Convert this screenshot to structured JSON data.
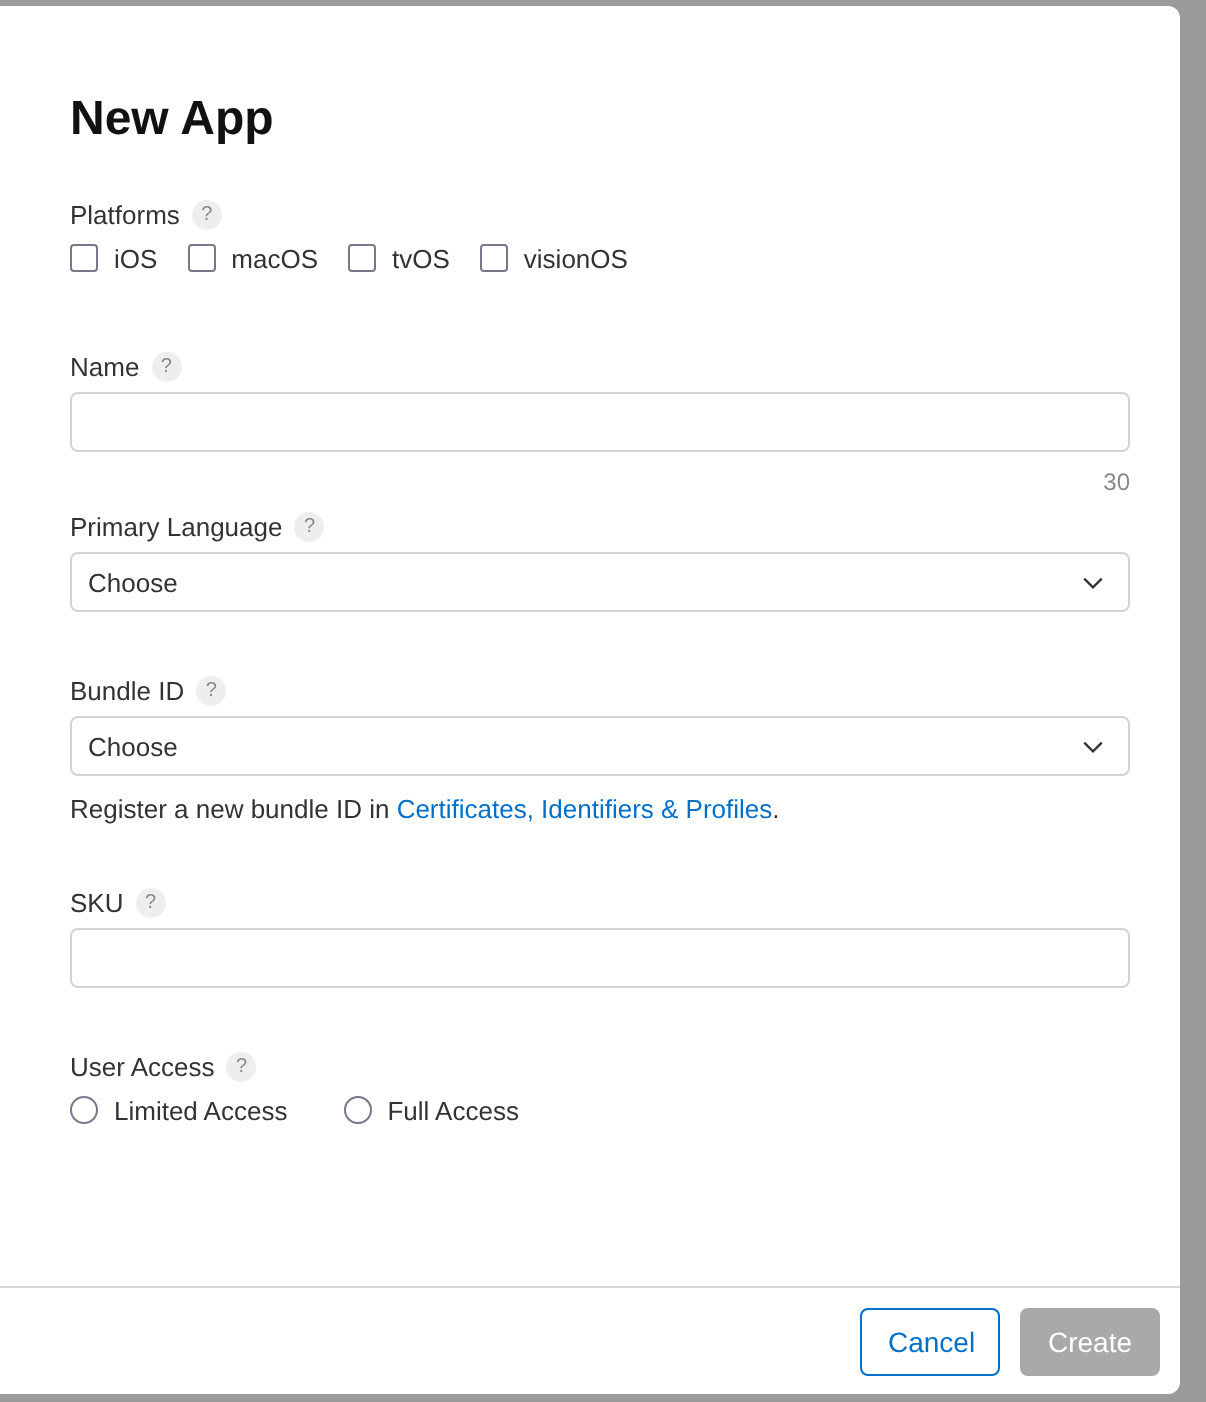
{
  "dialog": {
    "title": "New App",
    "fields": [
      {
        "kind": "checkboxes",
        "label": "Platforms",
        "help": "?",
        "options": [
          {
            "label": "iOS",
            "checked": false
          },
          {
            "label": "macOS",
            "checked": false
          },
          {
            "label": "tvOS",
            "checked": false
          },
          {
            "label": "visionOS",
            "checked": false
          }
        ]
      },
      {
        "kind": "text",
        "label": "Name",
        "help": "?",
        "counter": "30"
      },
      {
        "kind": "select",
        "label": "Primary Language",
        "help": "?",
        "value": "Choose"
      },
      {
        "kind": "select",
        "label": "Bundle ID",
        "help": "?",
        "value": "Choose",
        "note": {
          "text": "Register a new bundle ID in ",
          "link": "Certificates, Identifiers & Profiles",
          "after": "."
        }
      },
      {
        "kind": "text",
        "label": "SKU",
        "help": "?"
      },
      {
        "kind": "radios",
        "label": "User Access",
        "help": "?",
        "options": [
          {
            "label": "Limited Access",
            "selected": false
          },
          {
            "label": "Full Access",
            "selected": false
          }
        ]
      }
    ],
    "buttons": [
      {
        "label": "Cancel",
        "kind": "secondary",
        "disabled": false
      },
      {
        "label": "Create",
        "kind": "primary",
        "disabled": true
      }
    ]
  }
}
